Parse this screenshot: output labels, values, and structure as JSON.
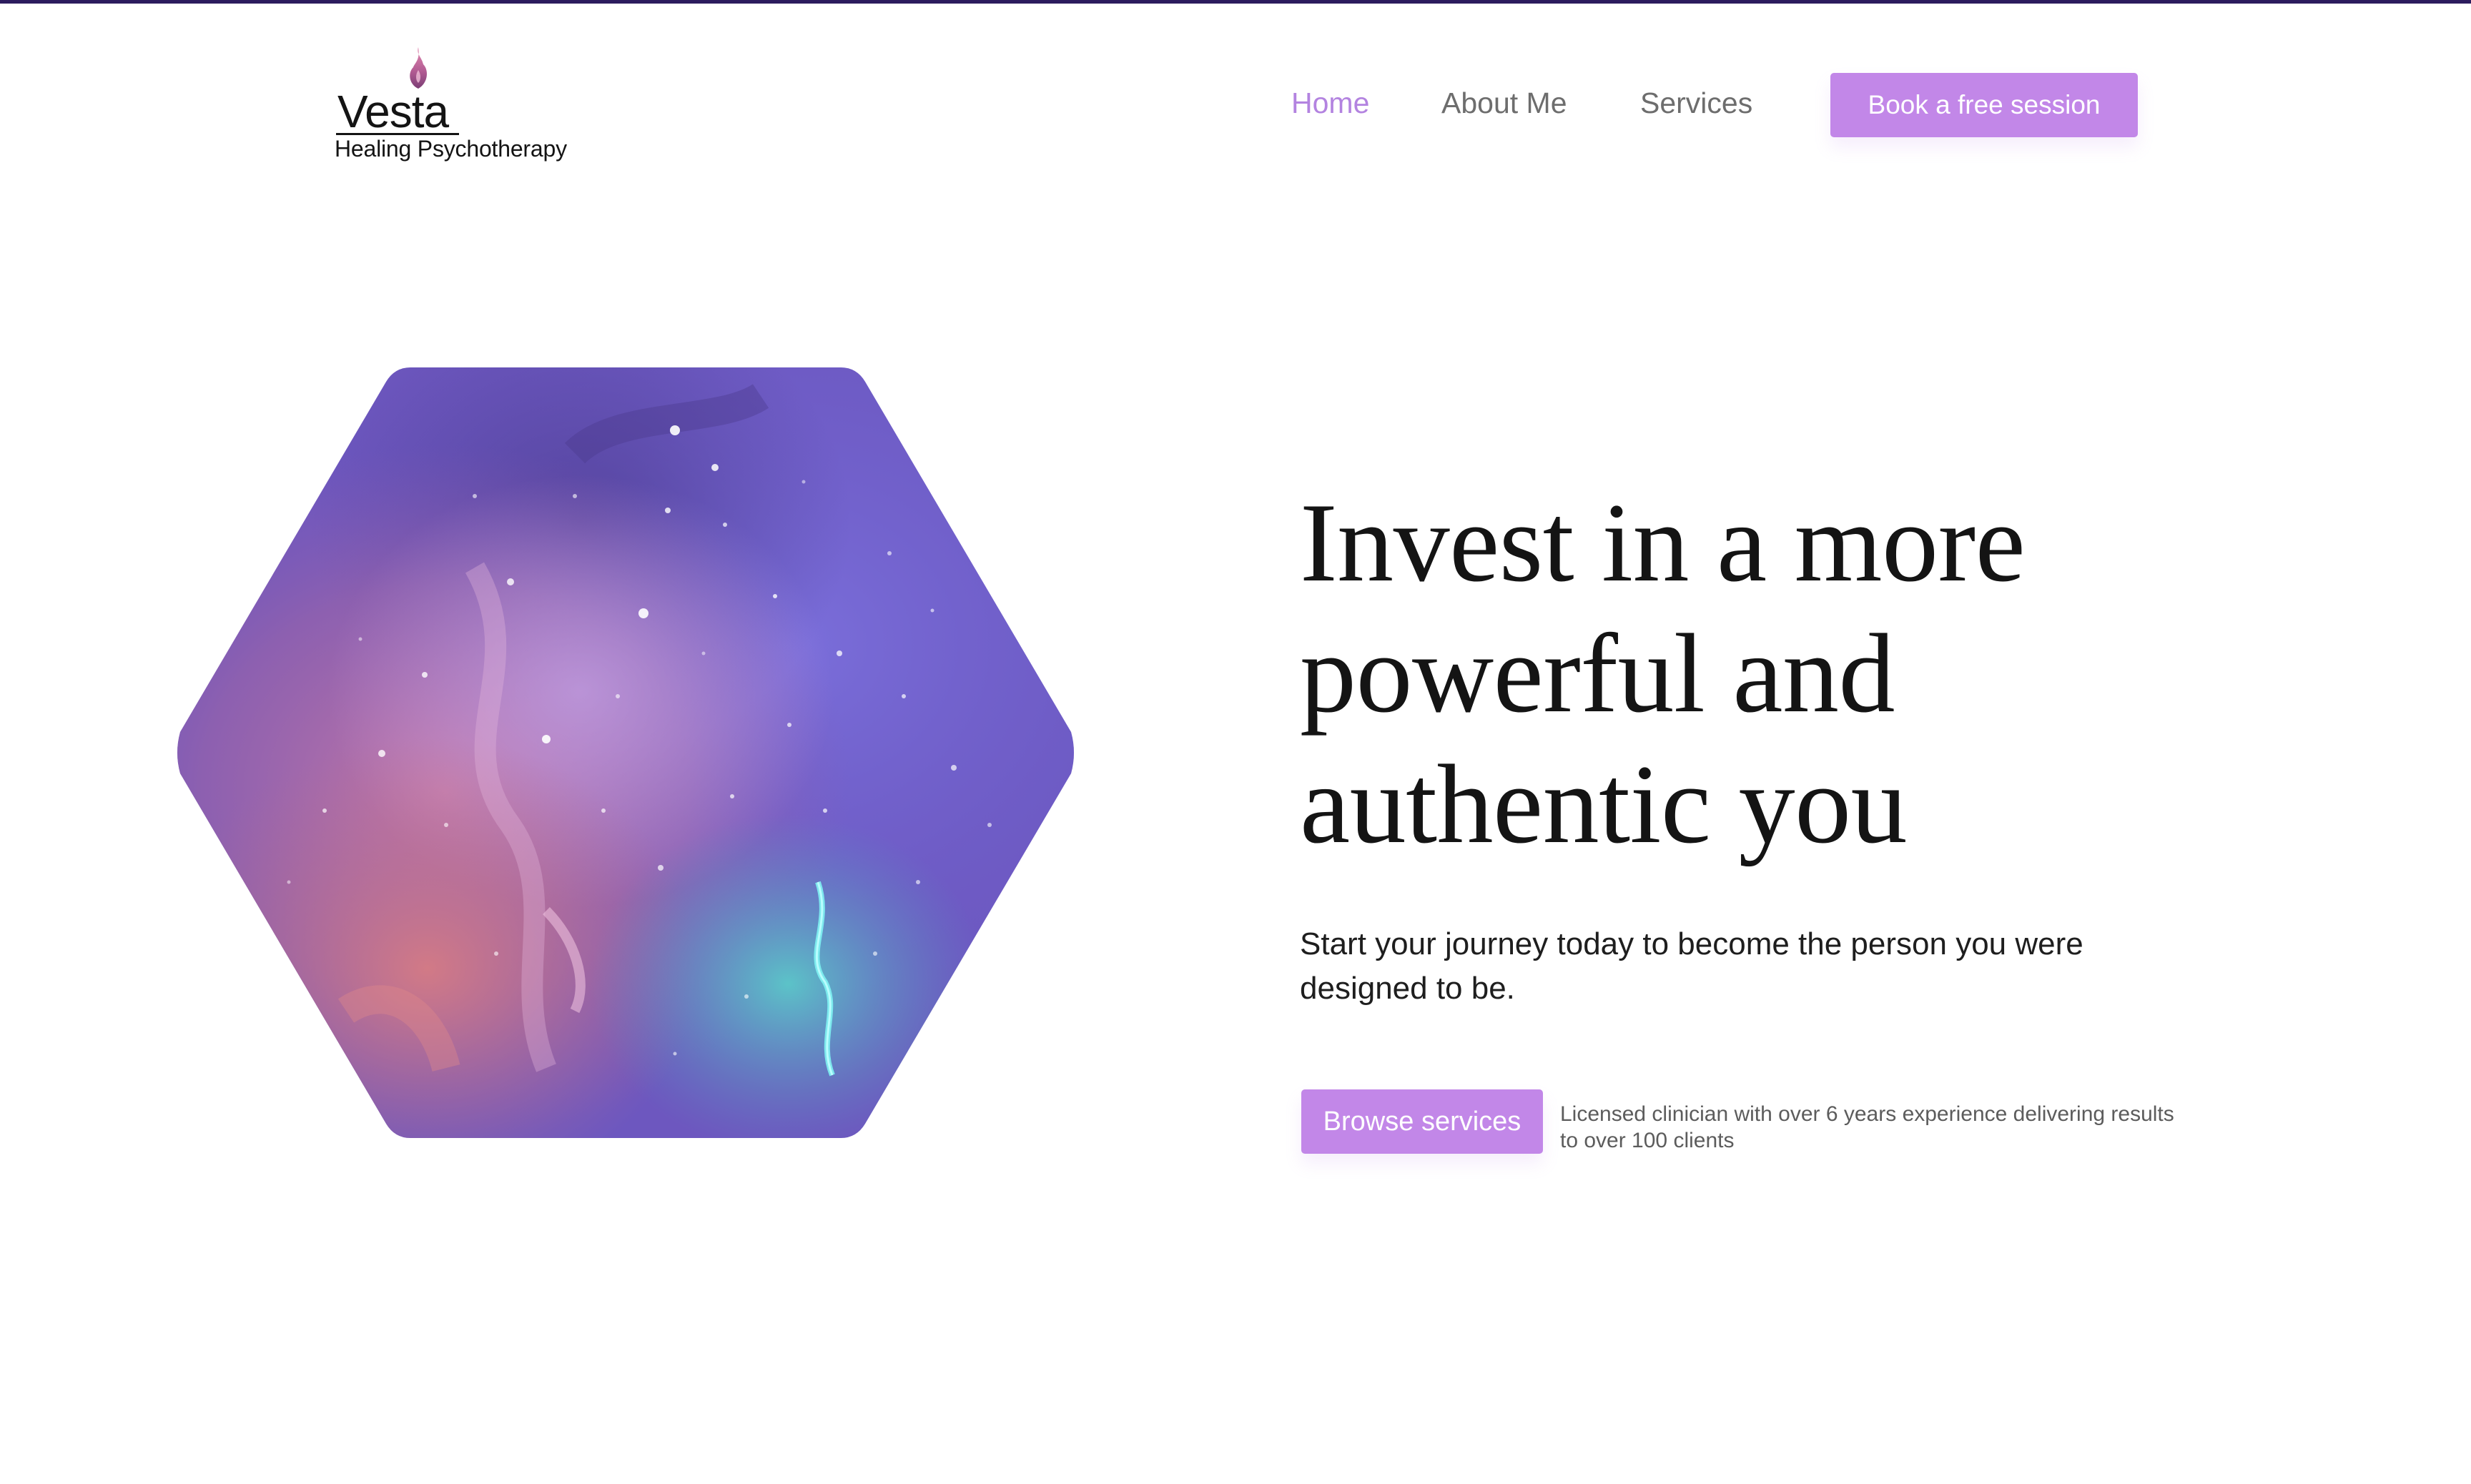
{
  "brand": {
    "name": "Vesta",
    "tagline": "Healing Psychotherapy"
  },
  "nav": {
    "items": [
      {
        "label": "Home",
        "active": true
      },
      {
        "label": "About Me",
        "active": false
      },
      {
        "label": "Services",
        "active": false
      }
    ],
    "cta_label": "Book a free session"
  },
  "hero": {
    "title": "Invest in a more powerful and authentic you",
    "subtitle": "Start your journey today to become the person you were designed to be.",
    "primary_button_label": "Browse services",
    "credentials_text": "Licensed clinician with over 6 years experience delivering results to over 100 clients",
    "image_icon": "galaxy-hexagon-image"
  },
  "colors": {
    "accent": "#c287e8",
    "nav_active": "#b383e0",
    "nav_inactive": "#6d6d6d",
    "text": "#141414",
    "top_border": "#2c1c5e",
    "background": "#ffffff"
  }
}
